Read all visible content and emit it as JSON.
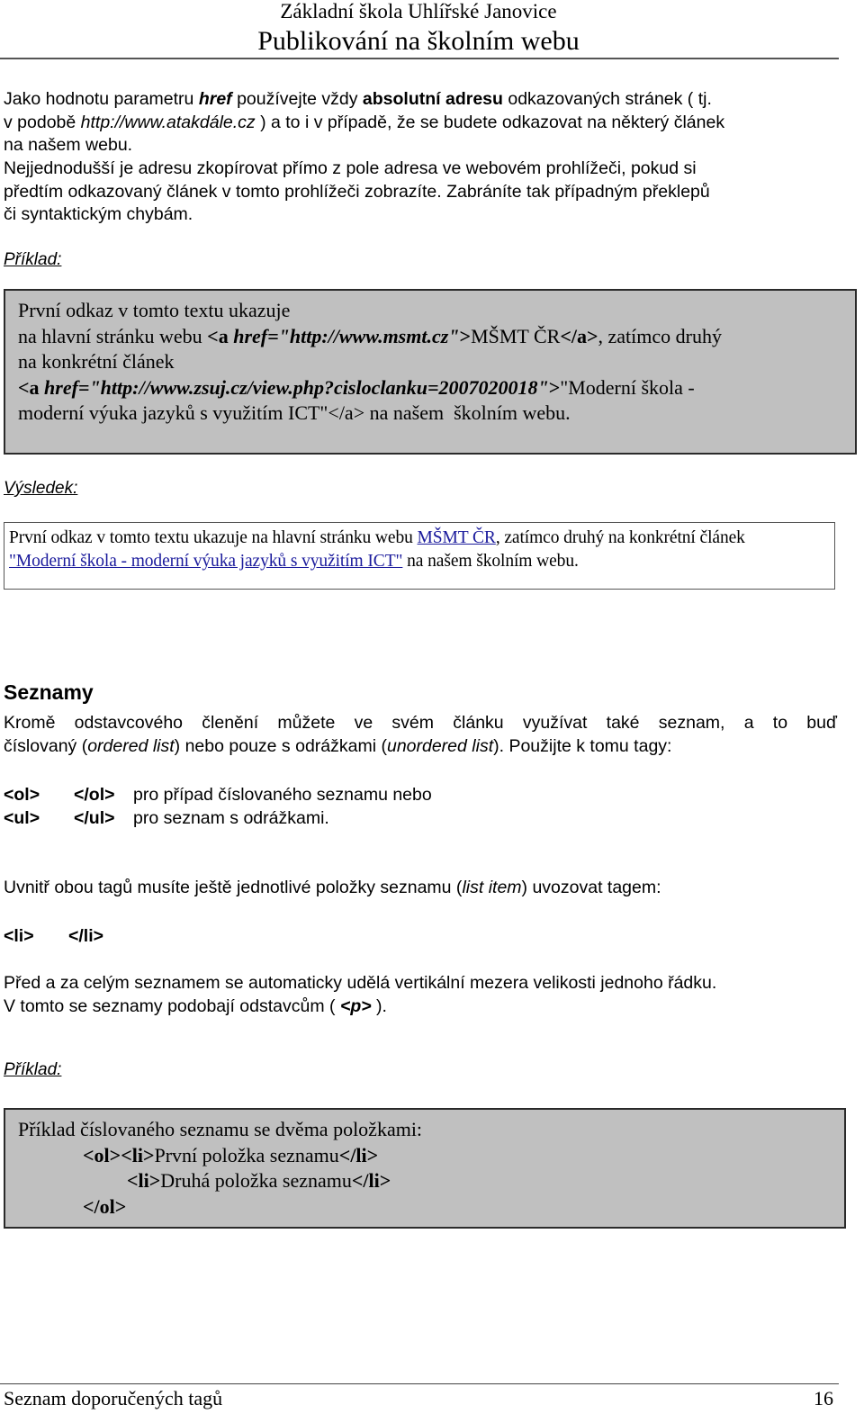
{
  "header": {
    "school": "Základní škola Uhlířské Janovice",
    "title": "Publikování  na  školním  webu"
  },
  "intro": {
    "p1_a": "Jako hodnotu parametru ",
    "p1_href": "href",
    "p1_b": " používejte  vždy ",
    "p1_bold": "absolutní adresu",
    "p1_c": " odkazovaných stránek ( tj.",
    "p1_d": "v podobě ",
    "p1_url": "http://www.atakdále.cz",
    "p1_e": " ) a to i v případě, že se budete odkazovat na některý článek",
    "p1_f": "na našem webu.",
    "p2_line1": "Nejjednodušší je adresu  zkopírovat přímo z pole adresa  ve webovém  prohlížeči, pokud si",
    "p2_line2": "předtím odkazovaný článek v tomto prohlížeči zobrazíte. Zabráníte tak případným překlepů",
    "p2_line3": "či syntaktickým chybám."
  },
  "example1": {
    "label": " Příklad:",
    "line1": "První odkaz v tomto textu ukazuje",
    "line2_a": "na hlavní stránku webu ",
    "line2_tag_open": "<a ",
    "line2_attr": "href=\"http://www.msmt.cz\"",
    "line2_gt": ">",
    "line2_text": "MŠMT ČR",
    "line2_tag_close": "</a>",
    "line2_b": ", zatímco druhý",
    "line3": "na konkrétní článek",
    "line4_tag_open": "<a ",
    "line4_attr": "href=\"http://www.zsuj.cz/view.php?cisloclanku=2007020018\"",
    "line4_gt": ">",
    "line4_text": "\"Moderní škola -",
    "line5": "moderní výuka jazyků s využitím ICT\"</a> na našem  školním webu."
  },
  "result1": {
    "label": "Výsledek:",
    "line1_a": "První odkaz v tomto textu ukazuje na hlavní stránku webu ",
    "link1": "MŠMT ČR",
    "line1_b": ", zatímco druhý na konkrétní článek",
    "link2": "\"Moderní škola - moderní výuka jazyků s využitím ICT\"",
    "line2_b": " na našem školním webu.",
    "link_color": "#1a1a9c"
  },
  "lists": {
    "heading": "Seznamy",
    "p1_line1": "Kromě odstavcového členění můžete ve svém článku využívat také seznam, a to buď",
    "p1_a": "číslovaný (",
    "p1_ol": "ordered list",
    "p1_b": ") nebo pouze s odrážkami (",
    "p1_ul": "unordered list",
    "p1_c": "). Použijte k tomu tagy:",
    "tags": [
      {
        "open": "<ol>",
        "close": "</ol>",
        "desc": "pro případ číslovaného seznamu nebo"
      },
      {
        "open": "<ul>",
        "close": "</ul>",
        "desc": "pro seznam s odrážkami."
      }
    ],
    "p2_a": "Uvnitř obou tagů musíte ještě jednotlivé položky seznamu (",
    "p2_italic": "list item",
    "p2_b": ") uvozovat tagem:",
    "li_open": "<li>",
    "li_close": "</li>",
    "p3_line1": "Před a za celým seznamem se automaticky udělá vertikální mezera velikosti jednoho řádku.",
    "p3_a": "V tomto se seznamy podobají odstavcům ( ",
    "p3_tag": "<p>",
    "p3_b": " )."
  },
  "example2": {
    "label": "Příklad:",
    "line1": "Příklad číslovaného seznamu se dvěma položkami:",
    "line2_ol": "<ol>",
    "line2_li": "<li>",
    "line2_text": "První položka seznamu",
    "line2_close": "</li>",
    "line3_li": "<li>",
    "line3_text": "Druhá položka seznamu",
    "line3_close": "</li>",
    "line4": "</ol>"
  },
  "footer": {
    "left": "Seznam doporučených tagů",
    "page_number": "16"
  },
  "colors": {
    "code_box_bg": "#c0c0c0",
    "link": "#1a1a9c"
  }
}
